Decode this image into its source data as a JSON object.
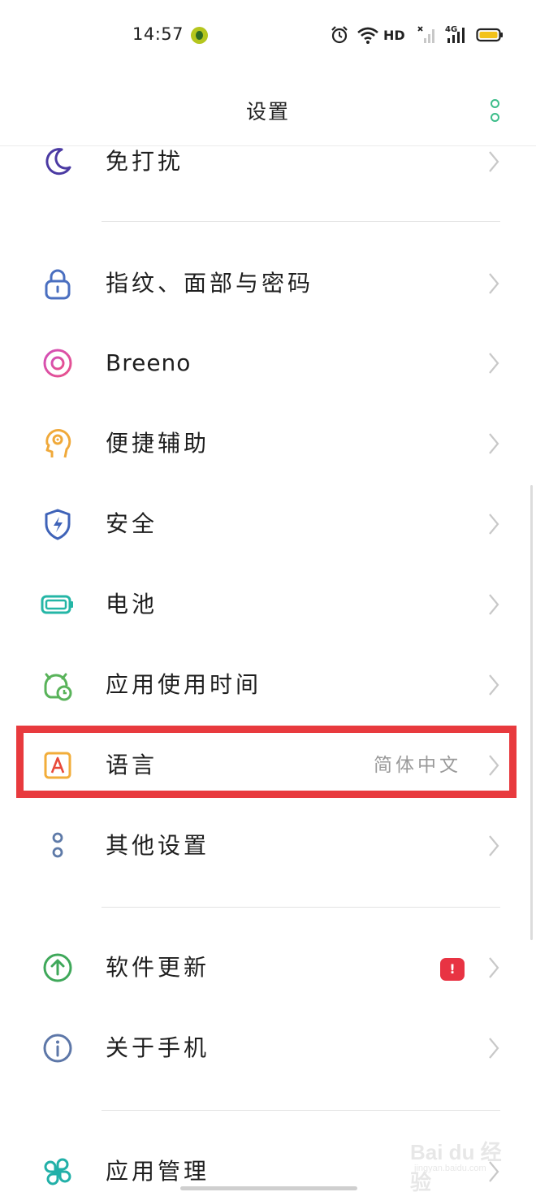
{
  "status_bar": {
    "time": "14:57",
    "hd_label": "HD",
    "network_label": "4G"
  },
  "header": {
    "title": "设置"
  },
  "settings": {
    "do_not_disturb": {
      "label": "免打扰",
      "icon": "moon-icon"
    },
    "fingerprint": {
      "label": "指纹、面部与密码",
      "icon": "lock-icon"
    },
    "breeno": {
      "label": "Breeno",
      "icon": "breeno-icon"
    },
    "accessibility": {
      "label": "便捷辅助",
      "icon": "head-icon"
    },
    "security": {
      "label": "安全",
      "icon": "shield-icon"
    },
    "battery": {
      "label": "电池",
      "icon": "battery-icon"
    },
    "screen_time": {
      "label": "应用使用时间",
      "icon": "clock-icon"
    },
    "language": {
      "label": "语言",
      "value": "简体中文",
      "icon": "language-icon"
    },
    "other_settings": {
      "label": "其他设置",
      "icon": "dots-icon"
    },
    "software_update": {
      "label": "软件更新",
      "badge": "!",
      "icon": "arrow-up-icon"
    },
    "about_phone": {
      "label": "关于手机",
      "icon": "info-icon"
    },
    "app_management": {
      "label": "应用管理",
      "icon": "apps-icon"
    }
  },
  "watermark": {
    "brand": "Bai du 经验",
    "url": "jingyan.baidu.com"
  },
  "colors": {
    "accent_green": "#3dbd8a",
    "highlight_red": "#e83a3e",
    "badge_red": "#e83343"
  }
}
